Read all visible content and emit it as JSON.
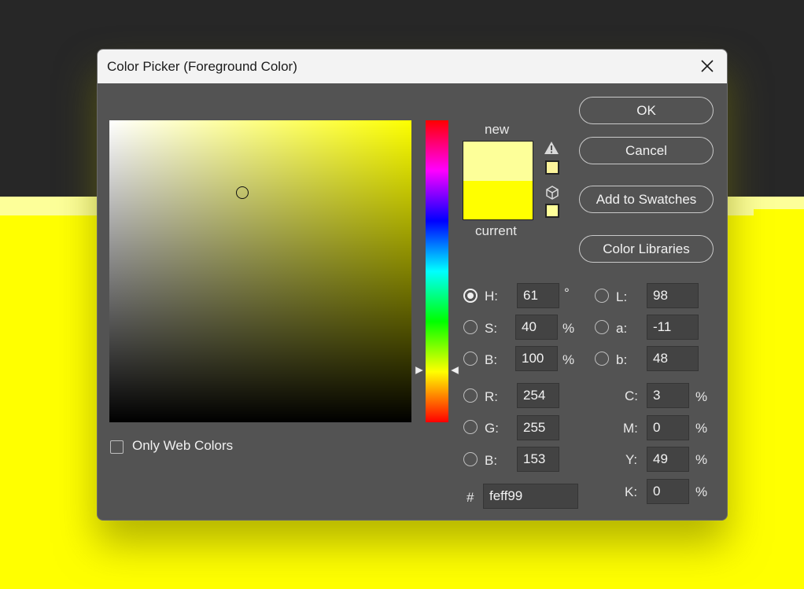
{
  "dialog": {
    "title": "Color Picker (Foreground Color)"
  },
  "colors": {
    "new": "#fdff99",
    "current": "#ffff00",
    "background": "#272727",
    "backdrop_yellow": "#ffff00"
  },
  "preview": {
    "new_label": "new",
    "current_label": "current"
  },
  "buttons": {
    "ok": "OK",
    "cancel": "Cancel",
    "add_to_swatches": "Add to Swatches",
    "color_libraries": "Color Libraries"
  },
  "hsb": {
    "h": {
      "label": "H:",
      "value": "61",
      "unit": "°",
      "selected": true
    },
    "s": {
      "label": "S:",
      "value": "40",
      "unit": "%"
    },
    "b": {
      "label": "B:",
      "value": "100",
      "unit": "%"
    }
  },
  "rgb": {
    "r": {
      "label": "R:",
      "value": "254"
    },
    "g": {
      "label": "G:",
      "value": "255"
    },
    "b": {
      "label": "B:",
      "value": "153"
    }
  },
  "lab": {
    "l": {
      "label": "L:",
      "value": "98"
    },
    "a": {
      "label": "a:",
      "value": "-11"
    },
    "b": {
      "label": "b:",
      "value": "48"
    }
  },
  "cmyk": {
    "c": {
      "label": "C:",
      "value": "3",
      "unit": "%"
    },
    "m": {
      "label": "M:",
      "value": "0",
      "unit": "%"
    },
    "y": {
      "label": "Y:",
      "value": "49",
      "unit": "%"
    },
    "k": {
      "label": "K:",
      "value": "0",
      "unit": "%"
    }
  },
  "hex": {
    "label": "#",
    "value": "feff99"
  },
  "web_colors": {
    "label": "Only Web Colors",
    "checked": false
  },
  "icons": {
    "close": "close-icon",
    "gamut_warning": "warning-icon",
    "web_safe": "cube-icon"
  }
}
